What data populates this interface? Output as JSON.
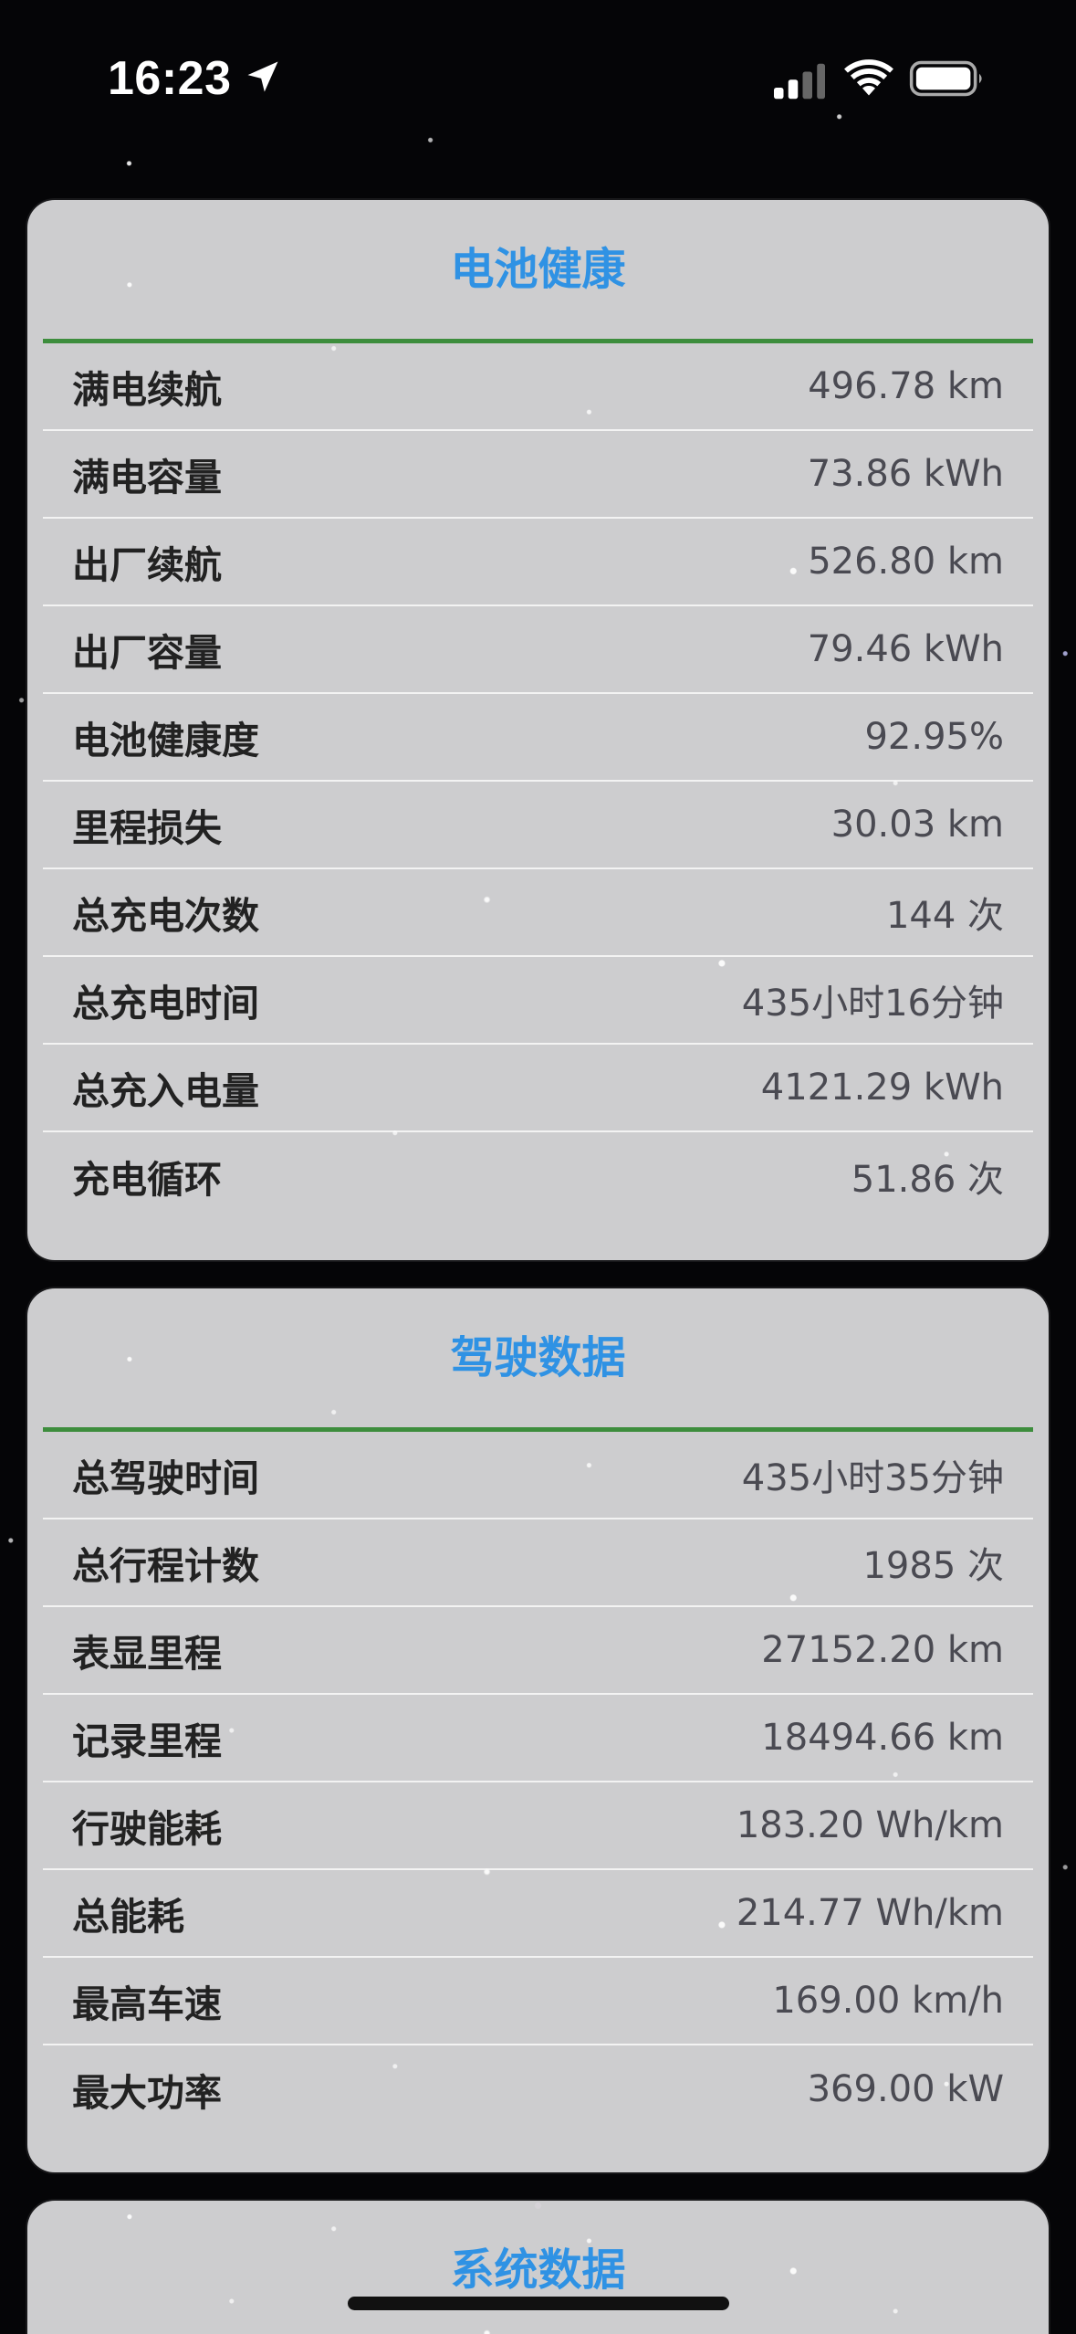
{
  "status_bar": {
    "time": "16:23",
    "icons": [
      "location-arrow-icon",
      "cellular-signal-icon",
      "wifi-icon",
      "battery-icon"
    ]
  },
  "colors": {
    "title": "#2f92e4",
    "divider": "#3d8d3d",
    "card_background": "#d4d4d6",
    "label": "#222222",
    "value": "#4a4a52"
  },
  "battery_health": {
    "title": "电池健康",
    "rows": [
      {
        "label": "满电续航",
        "value": "496.78 km"
      },
      {
        "label": "满电容量",
        "value": "73.86 kWh"
      },
      {
        "label": "出厂续航",
        "value": "526.80 km"
      },
      {
        "label": "出厂容量",
        "value": "79.46 kWh"
      },
      {
        "label": "电池健康度",
        "value": "92.95%"
      },
      {
        "label": "里程损失",
        "value": "30.03 km"
      },
      {
        "label": "总充电次数",
        "value": "144 次"
      },
      {
        "label": "总充电时间",
        "value": "435小时16分钟"
      },
      {
        "label": "总充入电量",
        "value": "4121.29 kWh"
      },
      {
        "label": "充电循环",
        "value": "51.86 次"
      }
    ]
  },
  "driving_data": {
    "title": "驾驶数据",
    "rows": [
      {
        "label": "总驾驶时间",
        "value": "435小时35分钟"
      },
      {
        "label": "总行程计数",
        "value": "1985 次"
      },
      {
        "label": "表显里程",
        "value": "27152.20 km"
      },
      {
        "label": "记录里程",
        "value": "18494.66 km"
      },
      {
        "label": "行驶能耗",
        "value": "183.20 Wh/km"
      },
      {
        "label": "总能耗",
        "value": "214.77 Wh/km"
      },
      {
        "label": "最高车速",
        "value": "169.00 km/h"
      },
      {
        "label": "最大功率",
        "value": "369.00 kW"
      }
    ]
  },
  "system_data": {
    "title": "系统数据"
  }
}
